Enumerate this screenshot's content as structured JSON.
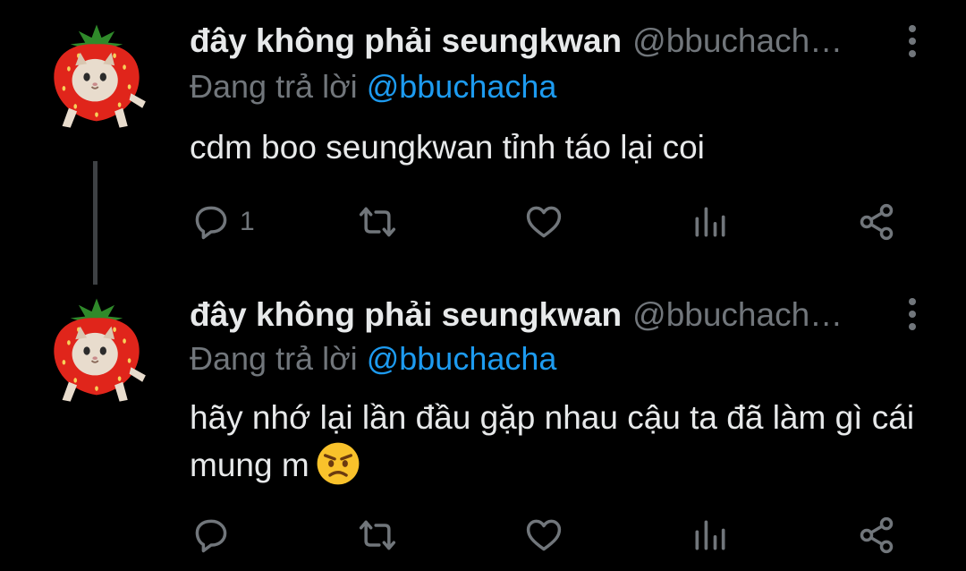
{
  "tweets": [
    {
      "display_name": "đây không phải seungkwan",
      "handle": "@bbuchach…",
      "reply_prefix": "Đang trả lời",
      "reply_to": "@bbuchacha",
      "text": "cdm boo seungkwan tỉnh táo lại coi",
      "reply_count": "1",
      "avatar_icon": "strawberry-cat-avatar"
    },
    {
      "display_name": "đây không phải seungkwan",
      "handle": "@bbuchach…",
      "reply_prefix": "Đang trả lời",
      "reply_to": "@bbuchacha",
      "text": "hãy nhớ lại lần đầu gặp nhau cậu ta đã làm gì cái mung m",
      "emoji": "angry-face-emoji",
      "reply_count": "",
      "avatar_icon": "strawberry-cat-avatar"
    }
  ],
  "colors": {
    "background": "#000000",
    "text_primary": "#e7e9ea",
    "text_secondary": "#71767b",
    "mention": "#1d9bf0",
    "thread_line": "#3e4144"
  },
  "icons": [
    "reply-icon",
    "retweet-icon",
    "like-icon",
    "views-icon",
    "share-icon",
    "more-icon"
  ]
}
